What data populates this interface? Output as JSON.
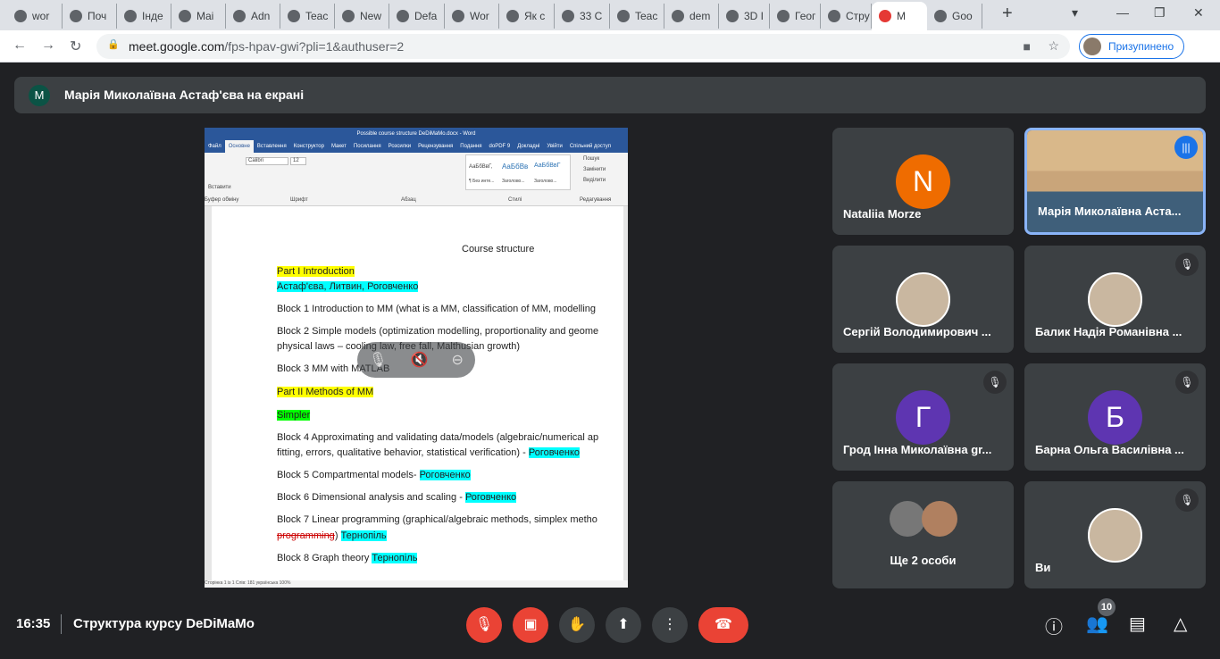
{
  "browser": {
    "tabs": [
      "wor",
      "Поч",
      "Інде",
      "Mai",
      "Adn",
      "Teac",
      "New",
      "Defa",
      "Wor",
      "Як с",
      "33 С",
      "Teac",
      "dem",
      "3D I",
      "Геог",
      "Стру",
      "M",
      "Goo"
    ],
    "active_tab": 16,
    "url_host": "meet.google.com",
    "url_path": "/fps-hpav-gwi?pli=1&authuser=2",
    "profile_status": "Призупинено"
  },
  "meet": {
    "presenter_banner": "Марія Миколаївна Астаф'єва на екрані",
    "time": "16:35",
    "meeting_title": "Структура курсу DeDiMaMo",
    "participants_count": "10",
    "participants": [
      {
        "name": "Nataliia Morze",
        "initial": "N",
        "color": "#ef6c00",
        "muted": false
      },
      {
        "name": "Марія Миколаївна Аста...",
        "video": true,
        "speaking": true
      },
      {
        "name": "Сергій Володимирович ...",
        "photo": true,
        "muted": false
      },
      {
        "name": "Балик Надія Романівна ...",
        "photo": true,
        "muted": true
      },
      {
        "name": "Грод Інна Миколаївна gr...",
        "initial": "Г",
        "color": "#5e35b1",
        "muted": true
      },
      {
        "name": "Барна Ольга Василівна ...",
        "initial": "Б",
        "color": "#5e35b1",
        "muted": true
      },
      {
        "name": "Ще 2 особи",
        "group": true
      },
      {
        "name": "Ви",
        "photo": true,
        "muted": true
      }
    ]
  },
  "word": {
    "title": "Possible course structure DeDiMaMo.docx - Word",
    "tabs": [
      "Файл",
      "Основне",
      "Вставлення",
      "Конструктор",
      "Макет",
      "Посилання",
      "Розсилки",
      "Рецензування",
      "Подання",
      "doPDF 9",
      "Докладні",
      "Увійти",
      "Спільний доступ"
    ],
    "ribbon": {
      "font": "Calibri",
      "size": "12",
      "paste": "Вставити",
      "groups": [
        "Буфер обміну",
        "Шрифт",
        "Абзац",
        "Стилі",
        "Редагування"
      ],
      "styles": [
        "АаБбВвГ,",
        "АаБбВв",
        "АаБбВвГ"
      ],
      "style_names": [
        "¶ Без инте...",
        "Заголово...",
        "Заголово..."
      ],
      "find": "Пошук",
      "replace": "Замінити",
      "select": "Виділити"
    },
    "status": "Сторінка 1 із 1   Слів: 181   українська   100%",
    "doc": {
      "heading": "Course structure",
      "part1": "Part I Introduction",
      "authors1": "Астаф'єва, Литвин, Роговченко",
      "b1": "Block 1 Introduction to MM (what is a MM, classification of MM, modelling",
      "b2a": "Block 2 Simple models (optimization modelling, proportionality and geome",
      "b2b": "physical laws – cooling law, free fall, Malthusian growth)",
      "b3": "Block 3 MM with MATLAB",
      "part2": "Part II Methods of MM",
      "simpler": "Simpler",
      "b4a": "Block 4 Approximating and validating data/models (algebraic/numerical ap",
      "b4b": "fitting, errors, qualitative behavior, statistical verification) - ",
      "b4c": "Роговченко",
      "b5": "Block 5 Compartmental models- ",
      "b5c": "Роговченко",
      "b6": "Block 6 Dimensional analysis and scaling - ",
      "b6c": "Роговченко",
      "b7a": "Block 7 Linear programming (graphical/algebraic methods, simplex metho",
      "b7b": "programming",
      "b7c": ") ",
      "b7d": "Тернопіль",
      "b8": "Block 8 Graph theory ",
      "b8c": "Тернопіль"
    }
  }
}
